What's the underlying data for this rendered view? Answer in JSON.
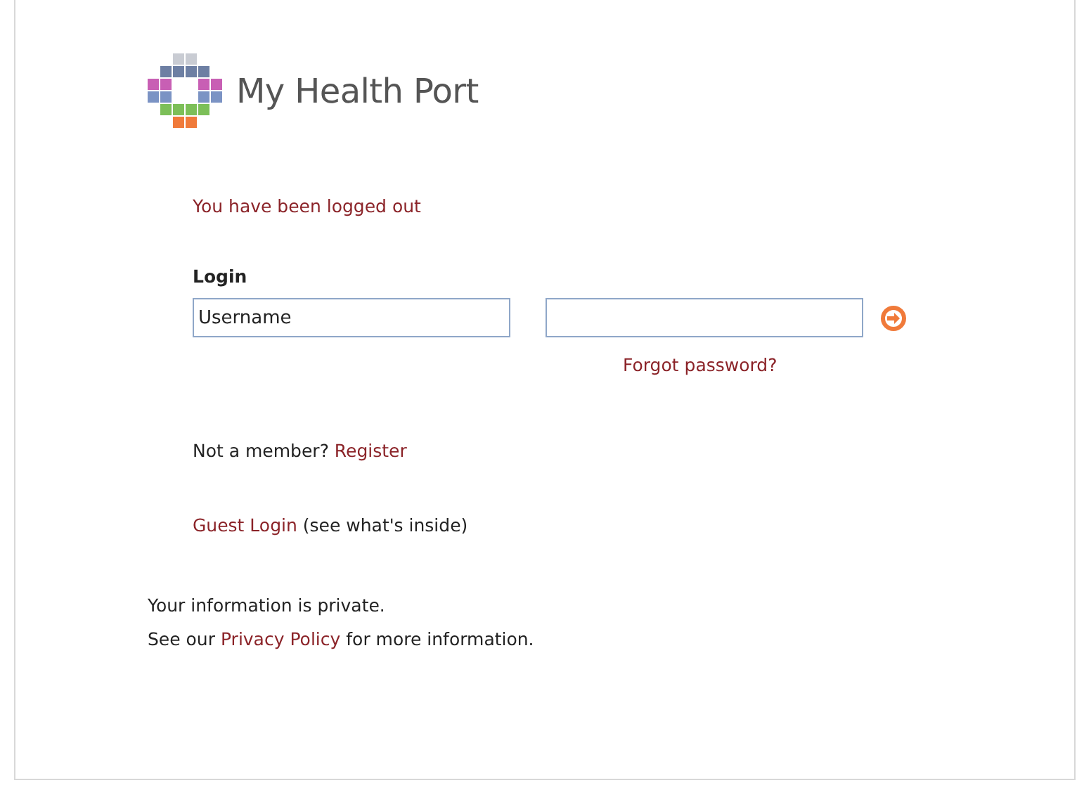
{
  "logo": {
    "name": "My Health Port"
  },
  "message": "You have been logged out",
  "login": {
    "heading": "Login",
    "username": {
      "value": "Username"
    },
    "forgot_link": "Forgot password?"
  },
  "register": {
    "text": "Not a member?",
    "link": "Register"
  },
  "guest": {
    "link": "Guest Login",
    "text": "(see what's inside)"
  },
  "privacy": {
    "line1": "Your information is private.",
    "before": "See our",
    "link": "Privacy Policy",
    "after": "for more information."
  }
}
